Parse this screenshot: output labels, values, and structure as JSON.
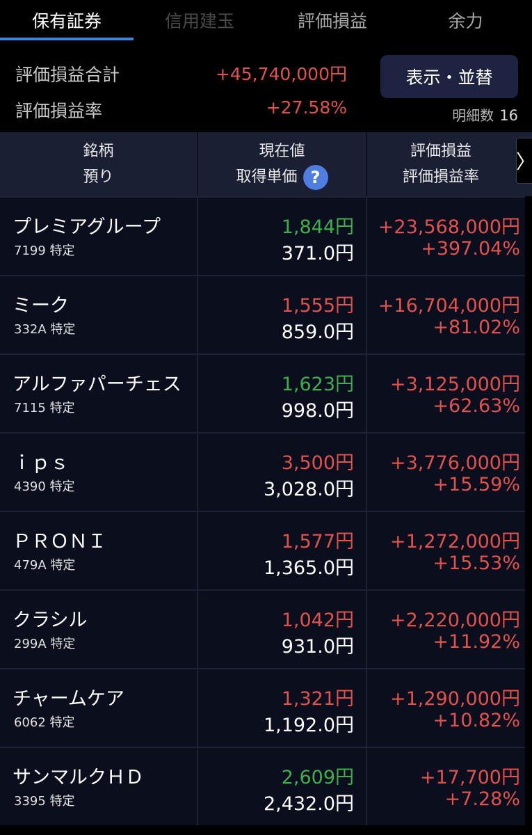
{
  "tabs": [
    "保有証券",
    "信用建玉",
    "評価損益",
    "余力"
  ],
  "summary": {
    "total_label": "評価損益合計",
    "total_value": "+45,740,000円",
    "rate_label": "評価損益率",
    "rate_value": "+27.58%",
    "sort_button": "表示・並替",
    "count_label": "明細数",
    "count_value": "16"
  },
  "header": {
    "col1_line1": "銘柄",
    "col1_line2": "預り",
    "col2_line1": "現在値",
    "col2_line2": "取得単価",
    "col3_line1": "評価損益",
    "col3_line2": "評価損益率",
    "help_glyph": "?",
    "next_glyph": "〉"
  },
  "holdings": [
    {
      "name": "プレミアグループ",
      "code": "7199 特定",
      "price": "1,844円",
      "price_dir": "up",
      "cost": "371.0円",
      "pl": "+23,568,000円",
      "pl_rate": "+397.04%"
    },
    {
      "name": "ミーク",
      "code": "332A 特定",
      "price": "1,555円",
      "price_dir": "down",
      "cost": "859.0円",
      "pl": "+16,704,000円",
      "pl_rate": "+81.02%"
    },
    {
      "name": "アルファパーチェス",
      "code": "7115 特定",
      "price": "1,623円",
      "price_dir": "up",
      "cost": "998.0円",
      "pl": "+3,125,000円",
      "pl_rate": "+62.63%"
    },
    {
      "name": "ｉｐｓ",
      "code": "4390 特定",
      "price": "3,500円",
      "price_dir": "down",
      "cost": "3,028.0円",
      "pl": "+3,776,000円",
      "pl_rate": "+15.59%"
    },
    {
      "name": "ＰＲＯＮＩ",
      "code": "479A 特定",
      "price": "1,577円",
      "price_dir": "down",
      "cost": "1,365.0円",
      "pl": "+1,272,000円",
      "pl_rate": "+15.53%"
    },
    {
      "name": "クラシル",
      "code": "299A 特定",
      "price": "1,042円",
      "price_dir": "down",
      "cost": "931.0円",
      "pl": "+2,220,000円",
      "pl_rate": "+11.92%"
    },
    {
      "name": "チャームケア",
      "code": "6062 特定",
      "price": "1,321円",
      "price_dir": "down",
      "cost": "1,192.0円",
      "pl": "+1,290,000円",
      "pl_rate": "+10.82%"
    },
    {
      "name": "サンマルクＨＤ",
      "code": "3395 特定",
      "price": "2,609円",
      "price_dir": "up",
      "cost": "2,432.0円",
      "pl": "+17,700円",
      "pl_rate": "+7.28%"
    }
  ],
  "colors": {
    "accent": "#3f86d6",
    "positive": "#e2524d",
    "price_up": "#3fae4d",
    "background": "#000000",
    "row_background": "#0b0e1d"
  }
}
